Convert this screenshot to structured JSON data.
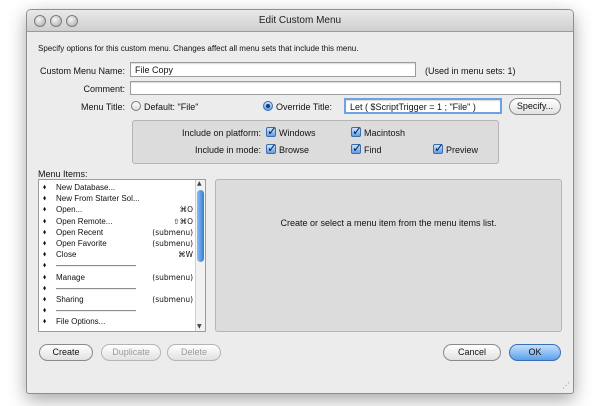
{
  "window": {
    "title": "Edit Custom Menu"
  },
  "instructions": "Specify options for this custom menu.  Changes affect all menu sets that include this menu.",
  "form": {
    "name_label": "Custom Menu Name:",
    "name_value": "File Copy",
    "used_in": "(Used in menu sets: 1)",
    "comment_label": "Comment:",
    "comment_value": "",
    "menu_title_label": "Menu Title:",
    "default_title_label": "Default: \"File\"",
    "override_title_label": "Override Title:",
    "override_value": "Let ( $ScriptTrigger = 1 ; \"File\" )",
    "specify_label": "Specify..."
  },
  "platform": {
    "label": "Include on platform:",
    "windows": "Windows",
    "macintosh": "Macintosh"
  },
  "mode": {
    "label": "Include in mode:",
    "browse": "Browse",
    "find": "Find",
    "preview": "Preview"
  },
  "menu_items": {
    "label": "Menu Items:",
    "items": [
      {
        "name": "New Database...",
        "shortcut": ""
      },
      {
        "name": "New From Starter Sol...",
        "shortcut": ""
      },
      {
        "name": "Open...",
        "shortcut": "⌘O"
      },
      {
        "name": "Open Remote...",
        "shortcut": "⇧⌘O"
      },
      {
        "name": "Open Recent",
        "shortcut": "(submenu)"
      },
      {
        "name": "Open Favorite",
        "shortcut": "(submenu)"
      },
      {
        "name": "Close",
        "shortcut": "⌘W"
      },
      {
        "name": "——————————",
        "shortcut": ""
      },
      {
        "name": "Manage",
        "shortcut": "(submenu)"
      },
      {
        "name": "——————————",
        "shortcut": ""
      },
      {
        "name": "Sharing",
        "shortcut": "(submenu)"
      },
      {
        "name": "——————————",
        "shortcut": ""
      },
      {
        "name": "File Options...",
        "shortcut": ""
      }
    ]
  },
  "detail_message": "Create or select a menu item from the menu items list.",
  "buttons": {
    "create": "Create",
    "duplicate": "Duplicate",
    "delete": "Delete",
    "cancel": "Cancel",
    "ok": "OK"
  }
}
